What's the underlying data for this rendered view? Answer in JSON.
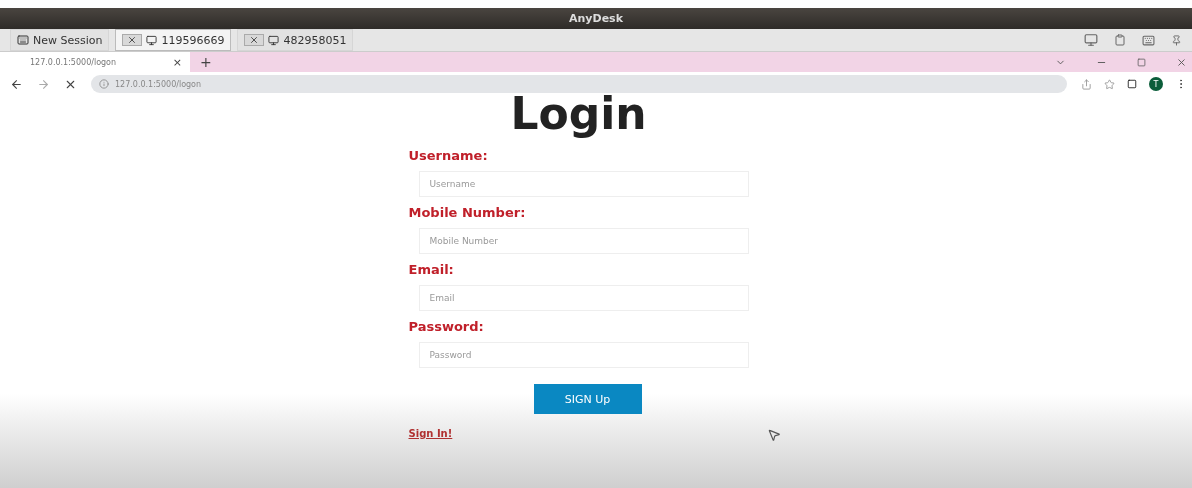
{
  "window": {
    "title": "AnyDesk"
  },
  "session_tabs": [
    {
      "label": "New Session",
      "kind": "new",
      "selected": false
    },
    {
      "label": "119596669",
      "kind": "remote",
      "selected": true
    },
    {
      "label": "482958051",
      "kind": "remote",
      "selected": false
    }
  ],
  "browser": {
    "tab": {
      "title": "127.0.0.1:5000/logon",
      "close": "×"
    },
    "new_tab": "+",
    "url": "127.0.0.1:5000/logon",
    "profile": "T"
  },
  "form": {
    "heading": "Login",
    "fields": [
      {
        "label": "Username:",
        "placeholder": "Username"
      },
      {
        "label": "Mobile Number:",
        "placeholder": "Mobile Number"
      },
      {
        "label": "Email:",
        "placeholder": "Email"
      },
      {
        "label": "Password:",
        "placeholder": "Password"
      }
    ],
    "submit": "SIGN Up",
    "link": "Sign In!"
  }
}
